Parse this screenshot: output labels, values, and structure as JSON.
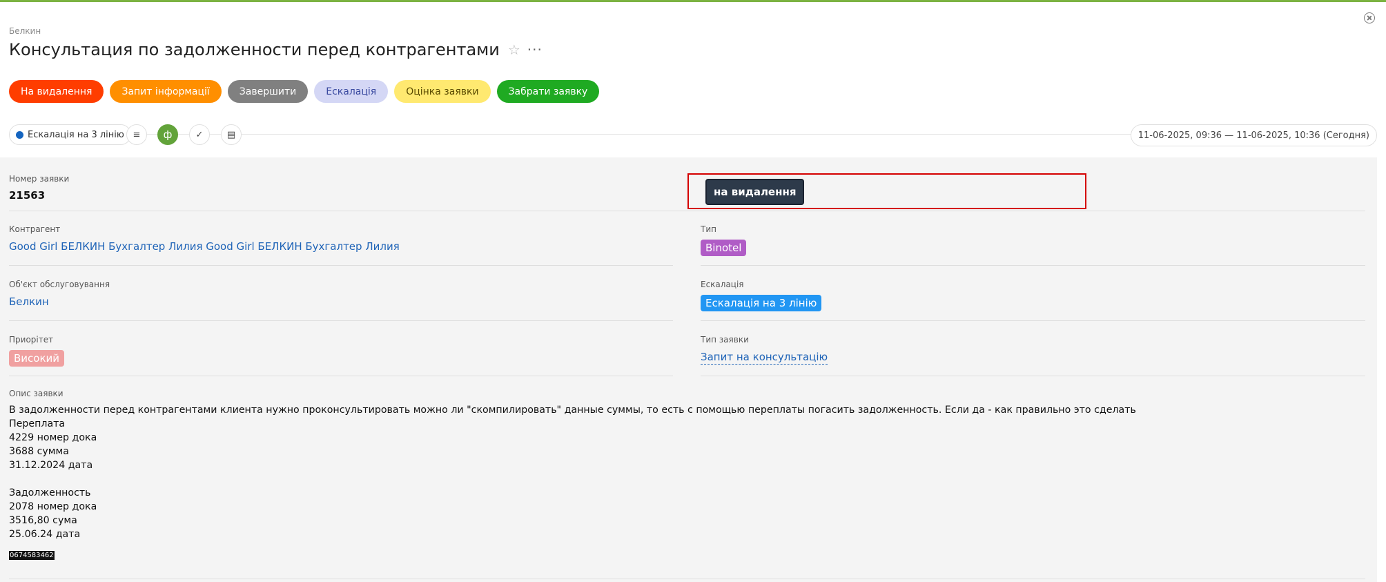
{
  "breadcrumb": "Белкин",
  "title": "Консультация по задолженности перед контрагентами",
  "actions": [
    {
      "label": "На видалення",
      "bg": "#ff3d00",
      "fg": "#ffffff"
    },
    {
      "label": "Запит інформації",
      "bg": "#ff8f00",
      "fg": "#ffffff"
    },
    {
      "label": "Завершити",
      "bg": "#808080",
      "fg": "#ffffff"
    },
    {
      "label": "Ескалація",
      "bg": "#d4d7f5",
      "fg": "#3a4aa0"
    },
    {
      "label": "Оцінка заявки",
      "bg": "#ffe970",
      "fg": "#5a4a00"
    },
    {
      "label": "Забрати заявку",
      "bg": "#1faa22",
      "fg": "#ffffff"
    }
  ],
  "status": {
    "stage": "Ескалація на 3 лінію",
    "date_range": "11-06-2025, 09:36 — 11-06-2025, 10:36  (Сегодня)"
  },
  "fields": {
    "number_label": "Номер заявки",
    "number_value": "21563",
    "status_tag": "на видалення",
    "contractor_label": "Контрагент",
    "contractor_value": "Good Girl БЕЛКИН Бухгалтер Лилия Good Girl БЕЛКИН Бухгалтер Лилия",
    "type_label": "Тип",
    "type_value": "Binotel",
    "object_label": "Об'єкт обслуговування",
    "object_value": "Белкин",
    "escalation_label": "Ескалація",
    "escalation_value": "Ескалація на 3 лінію",
    "priority_label": "Приорітет",
    "priority_value": "Високий",
    "request_type_label": "Тип заявки",
    "request_type_value": "Запит на консультацію",
    "description_label": "Опис заявки",
    "description_text": "В задолженности перед контрагентами клиента нужно проконсультировать можно ли \"скомпилировать\" данные суммы, то есть с помощью переплаты погасить задолженность. Если да - как правильно это сделать\nПереплата\n4229 номер дока\n3688 сумма\n31.12.2024 дата\n\nЗадолженность\n2078 номер дока\n3516,80 сума\n25.06.24 дата",
    "phone": "0674583462"
  },
  "colors": {
    "accent_green": "#7cb342",
    "type_tag": "#b05cc6",
    "escalation_tag": "#2196f3",
    "priority_tag": "#f0a0a0",
    "link": "#1e63b7",
    "highlight_border": "#d40000"
  },
  "icons": [
    "close-icon",
    "star-icon",
    "more-icon",
    "text-lines-icon",
    "f-letter-icon",
    "check-circle-icon",
    "note-icon"
  ]
}
